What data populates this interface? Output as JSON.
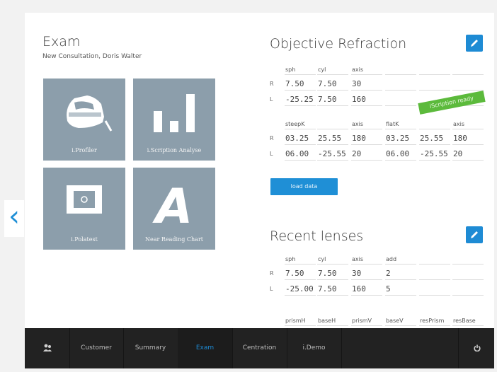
{
  "nav": {
    "back_icon": "chevron-left-icon"
  },
  "exam": {
    "title": "Exam",
    "subtitle": "New Consultation, Doris Walter"
  },
  "tiles": [
    {
      "label": "i.Profiler",
      "icon": "profiler-device-icon"
    },
    {
      "label": "i.Scription Analyse",
      "icon": "bar-chart-icon"
    },
    {
      "label": "i.Polatest",
      "icon": "polatest-screen-icon"
    },
    {
      "label": "Near Reading Chart",
      "icon": "letter-a-icon"
    }
  ],
  "objective": {
    "title": "Objective Refraction",
    "table1": {
      "headers": [
        "sph",
        "cyl",
        "axis",
        "",
        "",
        ""
      ],
      "rows": [
        {
          "side": "R",
          "cells": [
            "7.50",
            "7.50",
            "30",
            "",
            "",
            ""
          ]
        },
        {
          "side": "L",
          "cells": [
            "-25.25",
            "7.50",
            "160",
            "",
            "",
            ""
          ]
        }
      ]
    },
    "badge": "iScription ready",
    "table2": {
      "headers": [
        "steepK",
        "",
        "axis",
        "flatK",
        "",
        "axis"
      ],
      "rows": [
        {
          "side": "R",
          "cells": [
            "03.25",
            "25.55",
            "180",
            "03.25",
            "25.55",
            "180"
          ]
        },
        {
          "side": "L",
          "cells": [
            "06.00",
            "-25.55",
            "20",
            "06.00",
            "-25.55",
            "20"
          ]
        }
      ]
    },
    "load_button": "load data"
  },
  "recent": {
    "title": "Recent lenses",
    "table1": {
      "headers": [
        "sph",
        "cyl",
        "axis",
        "add",
        "",
        ""
      ],
      "rows": [
        {
          "side": "R",
          "cells": [
            "7.50",
            "7.50",
            "30",
            "2",
            "",
            ""
          ]
        },
        {
          "side": "L",
          "cells": [
            "-25.00",
            "7.50",
            "160",
            "5",
            "",
            ""
          ]
        }
      ]
    },
    "table2": {
      "headers": [
        "prismH",
        "baseH",
        "prismV",
        "baseV",
        "resPrism",
        "resBase"
      ]
    }
  },
  "bottom_nav": {
    "items": [
      "Customer",
      "Summary",
      "Exam",
      "Centration",
      "i.Demo"
    ],
    "active": "Exam",
    "left_icon": "users-icon",
    "right_icon": "power-icon"
  },
  "colors": {
    "accent": "#1e8bd4",
    "tile": "#8c9eab",
    "badge": "#5cba3c",
    "bar": "#222222"
  }
}
